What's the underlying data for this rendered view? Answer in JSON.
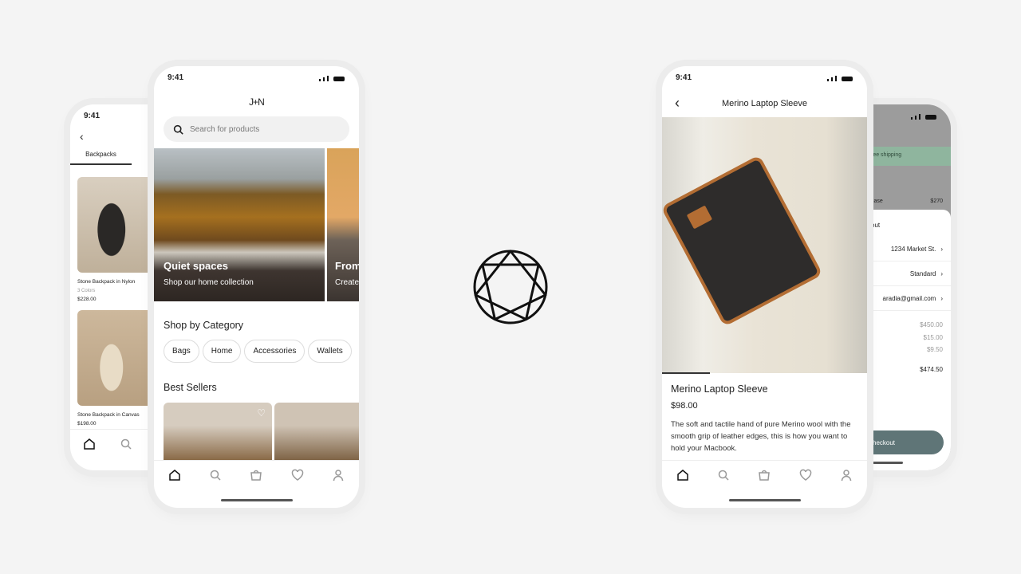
{
  "left_back": {
    "time": "9:41",
    "tab": "Backpacks",
    "products": [
      {
        "name": "Stone Backpack in Nylon",
        "colors": "3 Colors",
        "price": "$228.00"
      },
      {
        "name": "Stone Backpack in Canvas",
        "price": "$198.00"
      }
    ]
  },
  "home": {
    "time": "9:41",
    "logo": "J+N",
    "search_placeholder": "Search for products",
    "hero": [
      {
        "title": "Quiet spaces",
        "subtitle": "Shop our home collection"
      },
      {
        "title": "From",
        "subtitle": "Create"
      }
    ],
    "category_title": "Shop by Category",
    "categories": [
      "Bags",
      "Home",
      "Accessories",
      "Wallets"
    ],
    "best_title": "Best Sellers"
  },
  "product": {
    "time": "9:41",
    "title": "Merino Laptop Sleeve",
    "name": "Merino Laptop Sleeve",
    "price": "$98.00",
    "description": "The soft and tactile hand of pure Merino wool with the smooth grip of leather edges, this is how you want to hold your Macbook."
  },
  "checkout": {
    "banner": "ree shipping",
    "item": "case",
    "item_price": "$270",
    "sheet_title": "out",
    "address": "1234 Market St.",
    "shipping": "Standard",
    "email": "aradia@gmail.com",
    "subtotal": "$450.00",
    "ship_cost": "$15.00",
    "tax": "$9.50",
    "total": "$474.50",
    "button": "heckout",
    "accent": "#5f7577",
    "banner_color": "#8fb59e"
  },
  "center_logo": "heptagram-in-circle"
}
